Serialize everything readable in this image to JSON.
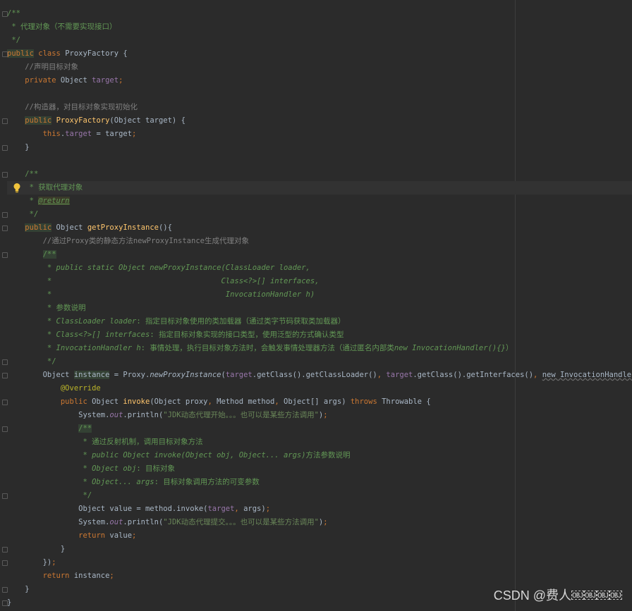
{
  "code_lines": [
    {
      "indent": "",
      "segs": [
        {
          "t": "/**",
          "c": "cm"
        }
      ]
    },
    {
      "indent": " ",
      "segs": [
        {
          "t": "* 代理对象（不需要实现接口）",
          "c": "cm"
        }
      ]
    },
    {
      "indent": " ",
      "segs": [
        {
          "t": "*/",
          "c": "cm"
        }
      ]
    },
    {
      "indent": "",
      "segs": [
        {
          "t": "public",
          "c": "kw hl"
        },
        {
          "t": " class ",
          "c": "kw"
        },
        {
          "t": "ProxyFactory {",
          "c": "id"
        }
      ]
    },
    {
      "indent": "    ",
      "segs": [
        {
          "t": "//声明目标对象",
          "c": "lc"
        }
      ]
    },
    {
      "indent": "    ",
      "segs": [
        {
          "t": "private ",
          "c": "kw"
        },
        {
          "t": "Object ",
          "c": "id"
        },
        {
          "t": "target",
          "c": "fld"
        },
        {
          "t": ";",
          "c": "kw"
        }
      ]
    },
    {
      "indent": "",
      "segs": []
    },
    {
      "indent": "    ",
      "segs": [
        {
          "t": "//构造器，对目标对象实现初始化",
          "c": "lc"
        }
      ]
    },
    {
      "indent": "    ",
      "segs": [
        {
          "t": "public",
          "c": "kw hl"
        },
        {
          "t": " ",
          "c": "id"
        },
        {
          "t": "ProxyFactory",
          "c": "fn"
        },
        {
          "t": "(Object target) {",
          "c": "id"
        }
      ]
    },
    {
      "indent": "        ",
      "segs": [
        {
          "t": "this",
          "c": "kw"
        },
        {
          "t": ".",
          "c": "id"
        },
        {
          "t": "target",
          "c": "fld"
        },
        {
          "t": " = target",
          "c": "id"
        },
        {
          "t": ";",
          "c": "kw"
        }
      ]
    },
    {
      "indent": "    ",
      "segs": [
        {
          "t": "}",
          "c": "id"
        }
      ]
    },
    {
      "indent": "",
      "segs": []
    },
    {
      "indent": "    ",
      "segs": [
        {
          "t": "/**",
          "c": "cm"
        }
      ]
    },
    {
      "indent": "     ",
      "segs": [
        {
          "t": "* 获取代理对象",
          "c": "cm"
        }
      ],
      "current": true,
      "bulb": true
    },
    {
      "indent": "     ",
      "segs": [
        {
          "t": "* ",
          "c": "cm"
        },
        {
          "t": "@return",
          "c": "tag"
        }
      ]
    },
    {
      "indent": "     ",
      "segs": [
        {
          "t": "*/",
          "c": "cm"
        }
      ]
    },
    {
      "indent": "    ",
      "segs": [
        {
          "t": "public",
          "c": "kw hl"
        },
        {
          "t": " Object ",
          "c": "id"
        },
        {
          "t": "getProxyInstance",
          "c": "fn"
        },
        {
          "t": "(){",
          "c": "id"
        }
      ]
    },
    {
      "indent": "        ",
      "segs": [
        {
          "t": "//通过Proxy类的静态方法newProxyInstance生成代理对象",
          "c": "lc"
        }
      ]
    },
    {
      "indent": "        ",
      "segs": [
        {
          "t": "/**",
          "c": "cm hl"
        }
      ]
    },
    {
      "indent": "         ",
      "segs": [
        {
          "t": "* public static Object newProxyInstance(ClassLoader loader,",
          "c": "cmi"
        }
      ]
    },
    {
      "indent": "         ",
      "segs": [
        {
          "t": "*                                      Class<?>[] interfaces,",
          "c": "cmi"
        }
      ]
    },
    {
      "indent": "         ",
      "segs": [
        {
          "t": "*                                       InvocationHandler h)",
          "c": "cmi"
        }
      ]
    },
    {
      "indent": "         ",
      "segs": [
        {
          "t": "* 参数说明",
          "c": "cm"
        }
      ]
    },
    {
      "indent": "         ",
      "segs": [
        {
          "t": "* ClassLoader loader",
          "c": "cmi"
        },
        {
          "t": ": 指定目标对象使用的类加载器（通过类字节码获取类加载器）",
          "c": "cm"
        }
      ]
    },
    {
      "indent": "         ",
      "segs": [
        {
          "t": "* Class<?>[] interfaces",
          "c": "cmi"
        },
        {
          "t": ": 指定目标对象实现的接口类型，使用泛型的方式确认类型",
          "c": "cm"
        }
      ]
    },
    {
      "indent": "         ",
      "segs": [
        {
          "t": "* InvocationHandler h",
          "c": "cmi"
        },
        {
          "t": ": 事情处理，执行目标对象方法时，会触发事情处理器方法（通过匿名内部类",
          "c": "cm"
        },
        {
          "t": "new InvocationHandler(){}",
          "c": "cmi"
        },
        {
          "t": "）",
          "c": "cm"
        }
      ]
    },
    {
      "indent": "         ",
      "segs": [
        {
          "t": "*/",
          "c": "cm"
        }
      ]
    },
    {
      "indent": "        ",
      "segs": [
        {
          "t": "Object ",
          "c": "id"
        },
        {
          "t": "instance",
          "c": "id hl"
        },
        {
          "t": " = Proxy.",
          "c": "id"
        },
        {
          "t": "newProxyInstance",
          "c": "sm"
        },
        {
          "t": "(",
          "c": "id"
        },
        {
          "t": "target",
          "c": "fld"
        },
        {
          "t": ".getClass().getClassLoader()",
          "c": "id"
        },
        {
          "t": ", ",
          "c": "kw"
        },
        {
          "t": "target",
          "c": "fld"
        },
        {
          "t": ".getClass().getInterfaces()",
          "c": "id"
        },
        {
          "t": ", ",
          "c": "kw"
        },
        {
          "t": "new InvocationHandler()",
          "c": "id wavy"
        },
        {
          "t": " {",
          "c": "id"
        }
      ]
    },
    {
      "indent": "            ",
      "segs": [
        {
          "t": "@Override",
          "c": "an"
        }
      ]
    },
    {
      "indent": "            ",
      "segs": [
        {
          "t": "public ",
          "c": "kw"
        },
        {
          "t": "Object ",
          "c": "id"
        },
        {
          "t": "invoke",
          "c": "fn"
        },
        {
          "t": "(Object proxy",
          "c": "id"
        },
        {
          "t": ", ",
          "c": "kw"
        },
        {
          "t": "Method method",
          "c": "id"
        },
        {
          "t": ", ",
          "c": "kw"
        },
        {
          "t": "Object[] args) ",
          "c": "id"
        },
        {
          "t": "throws ",
          "c": "kw"
        },
        {
          "t": "Throwable {",
          "c": "id"
        }
      ]
    },
    {
      "indent": "                ",
      "segs": [
        {
          "t": "System.",
          "c": "id"
        },
        {
          "t": "out",
          "c": "sfld"
        },
        {
          "t": ".println(",
          "c": "id"
        },
        {
          "t": "\"JDK动态代理开始。。。也可以是某些方法调用\"",
          "c": "st"
        },
        {
          "t": ")",
          "c": "id"
        },
        {
          "t": ";",
          "c": "kw"
        }
      ]
    },
    {
      "indent": "                ",
      "segs": [
        {
          "t": "/**",
          "c": "cm hl"
        }
      ]
    },
    {
      "indent": "                 ",
      "segs": [
        {
          "t": "* 通过反射机制，调用目标对象方法",
          "c": "cm"
        }
      ]
    },
    {
      "indent": "                 ",
      "segs": [
        {
          "t": "* public Object invoke(Object obj, Object... args)",
          "c": "cmi"
        },
        {
          "t": "方法参数说明",
          "c": "cm"
        }
      ]
    },
    {
      "indent": "                 ",
      "segs": [
        {
          "t": "* Object obj",
          "c": "cmi"
        },
        {
          "t": ": 目标对象",
          "c": "cm"
        }
      ]
    },
    {
      "indent": "                 ",
      "segs": [
        {
          "t": "* Object... args",
          "c": "cmi"
        },
        {
          "t": ": 目标对象调用方法的可变参数",
          "c": "cm"
        }
      ]
    },
    {
      "indent": "                 ",
      "segs": [
        {
          "t": "*/",
          "c": "cm"
        }
      ]
    },
    {
      "indent": "                ",
      "segs": [
        {
          "t": "Object value = method.invoke(",
          "c": "id"
        },
        {
          "t": "target",
          "c": "fld"
        },
        {
          "t": ", ",
          "c": "kw"
        },
        {
          "t": "args)",
          "c": "id"
        },
        {
          "t": ";",
          "c": "kw"
        }
      ]
    },
    {
      "indent": "                ",
      "segs": [
        {
          "t": "System.",
          "c": "id"
        },
        {
          "t": "out",
          "c": "sfld"
        },
        {
          "t": ".println(",
          "c": "id"
        },
        {
          "t": "\"JDK动态代理提交。。。也可以是某些方法调用\"",
          "c": "st"
        },
        {
          "t": ")",
          "c": "id"
        },
        {
          "t": ";",
          "c": "kw"
        }
      ]
    },
    {
      "indent": "                ",
      "segs": [
        {
          "t": "return ",
          "c": "kw"
        },
        {
          "t": "value",
          "c": "id"
        },
        {
          "t": ";",
          "c": "kw"
        }
      ]
    },
    {
      "indent": "            ",
      "segs": [
        {
          "t": "}",
          "c": "id"
        }
      ]
    },
    {
      "indent": "        ",
      "segs": [
        {
          "t": "})",
          "c": "id"
        },
        {
          "t": ";",
          "c": "kw"
        }
      ]
    },
    {
      "indent": "        ",
      "segs": [
        {
          "t": "return ",
          "c": "kw"
        },
        {
          "t": "instance",
          "c": "id"
        },
        {
          "t": ";",
          "c": "kw"
        }
      ]
    },
    {
      "indent": "    ",
      "segs": [
        {
          "t": "}",
          "c": "id"
        }
      ]
    },
    {
      "indent": "",
      "segs": [
        {
          "t": "}",
          "c": "id"
        }
      ]
    }
  ],
  "fold_lines": [
    0,
    3,
    8,
    10,
    12,
    15,
    16,
    18,
    26,
    27,
    29,
    31,
    36,
    40,
    41,
    43,
    44
  ],
  "watermark": "CSDN @费人￼￼￼￼",
  "icons": {
    "intention": "lightbulb-icon",
    "fold": "fold-marker-icon"
  }
}
